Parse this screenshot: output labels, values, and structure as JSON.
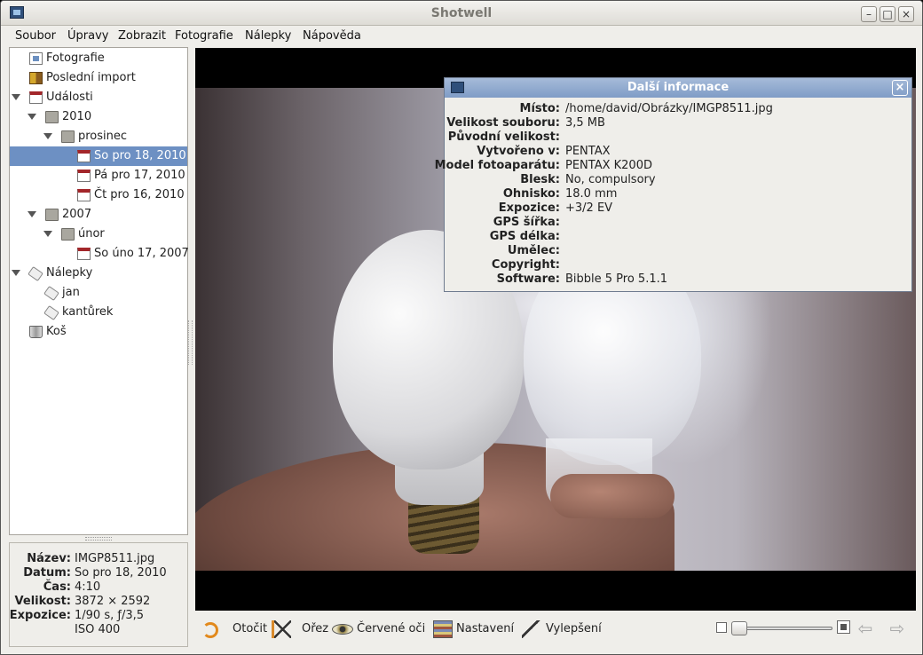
{
  "window": {
    "title": "Shotwell"
  },
  "menubar": [
    "Soubor",
    "Úpravy",
    "Zobrazit",
    "Fotografie",
    "Nálepky",
    "Nápověda"
  ],
  "sidebar": {
    "items": [
      {
        "label": "Fotografie",
        "icon": "photos-icon",
        "level": 0,
        "expander": false
      },
      {
        "label": "Poslední import",
        "icon": "import-icon",
        "level": 0,
        "expander": false
      },
      {
        "label": "Události",
        "icon": "events-icon",
        "level": 0,
        "expander": true
      },
      {
        "label": "2010",
        "icon": "folder-icon",
        "level": 1,
        "expander": true
      },
      {
        "label": "prosinec",
        "icon": "folder-icon",
        "level": 2,
        "expander": true
      },
      {
        "label": "So pro 18, 2010",
        "icon": "event-icon",
        "level": 3,
        "expander": false,
        "selected": true
      },
      {
        "label": "Pá pro 17, 2010",
        "icon": "event-icon",
        "level": 3,
        "expander": false
      },
      {
        "label": "Čt pro 16, 2010",
        "icon": "event-icon",
        "level": 3,
        "expander": false
      },
      {
        "label": "2007",
        "icon": "folder-icon",
        "level": 1,
        "expander": true
      },
      {
        "label": "únor",
        "icon": "folder-icon",
        "level": 2,
        "expander": true
      },
      {
        "label": "So úno 17, 2007",
        "icon": "event-icon",
        "level": 3,
        "expander": false
      },
      {
        "label": "Nálepky",
        "icon": "tags-icon",
        "level": 0,
        "expander": true
      },
      {
        "label": "jan",
        "icon": "tag-icon",
        "level": 1,
        "expander": false
      },
      {
        "label": "kantůrek",
        "icon": "tag-icon",
        "level": 1,
        "expander": false
      },
      {
        "label": "Koš",
        "icon": "trash-icon",
        "level": 0,
        "expander": false
      }
    ]
  },
  "info_panel": [
    {
      "key": "Název:",
      "value": "IMGP8511.jpg"
    },
    {
      "key": "Datum:",
      "value": "So pro 18, 2010"
    },
    {
      "key": "Čas:",
      "value": "4:10"
    },
    {
      "key": "Velikost:",
      "value": "3872 × 2592"
    },
    {
      "key": "Expozice:",
      "value": "1/90 s, ƒ/3,5"
    },
    {
      "key": "",
      "value": "ISO 400"
    }
  ],
  "dialog": {
    "title": "Další informace",
    "close": "×",
    "rows": [
      {
        "key": "Místo:",
        "value": "/home/david/Obrázky/IMGP8511.jpg"
      },
      {
        "key": "Velikost souboru:",
        "value": "3,5 MB"
      },
      {
        "key": "Původní velikost:",
        "value": ""
      },
      {
        "key": "Vytvořeno v:",
        "value": "PENTAX"
      },
      {
        "key": "Model fotoaparátu:",
        "value": "PENTAX K200D"
      },
      {
        "key": "Blesk:",
        "value": "No, compulsory"
      },
      {
        "key": "Ohnisko:",
        "value": "18.0 mm"
      },
      {
        "key": "Expozice:",
        "value": "+3/2 EV"
      },
      {
        "key": "GPS šířka:",
        "value": ""
      },
      {
        "key": "GPS délka:",
        "value": ""
      },
      {
        "key": "Umělec:",
        "value": ""
      },
      {
        "key": "Copyright:",
        "value": ""
      },
      {
        "key": "Software:",
        "value": "Bibble 5 Pro 5.1.1"
      }
    ]
  },
  "toolbar": {
    "rotate": "Otočit",
    "crop": "Ořez",
    "redeye": "Červené oči",
    "adjust": "Nastavení",
    "enhance": "Vylepšení",
    "zoom_fraction": 0.0,
    "prev": "⇦",
    "next": "⇨"
  }
}
